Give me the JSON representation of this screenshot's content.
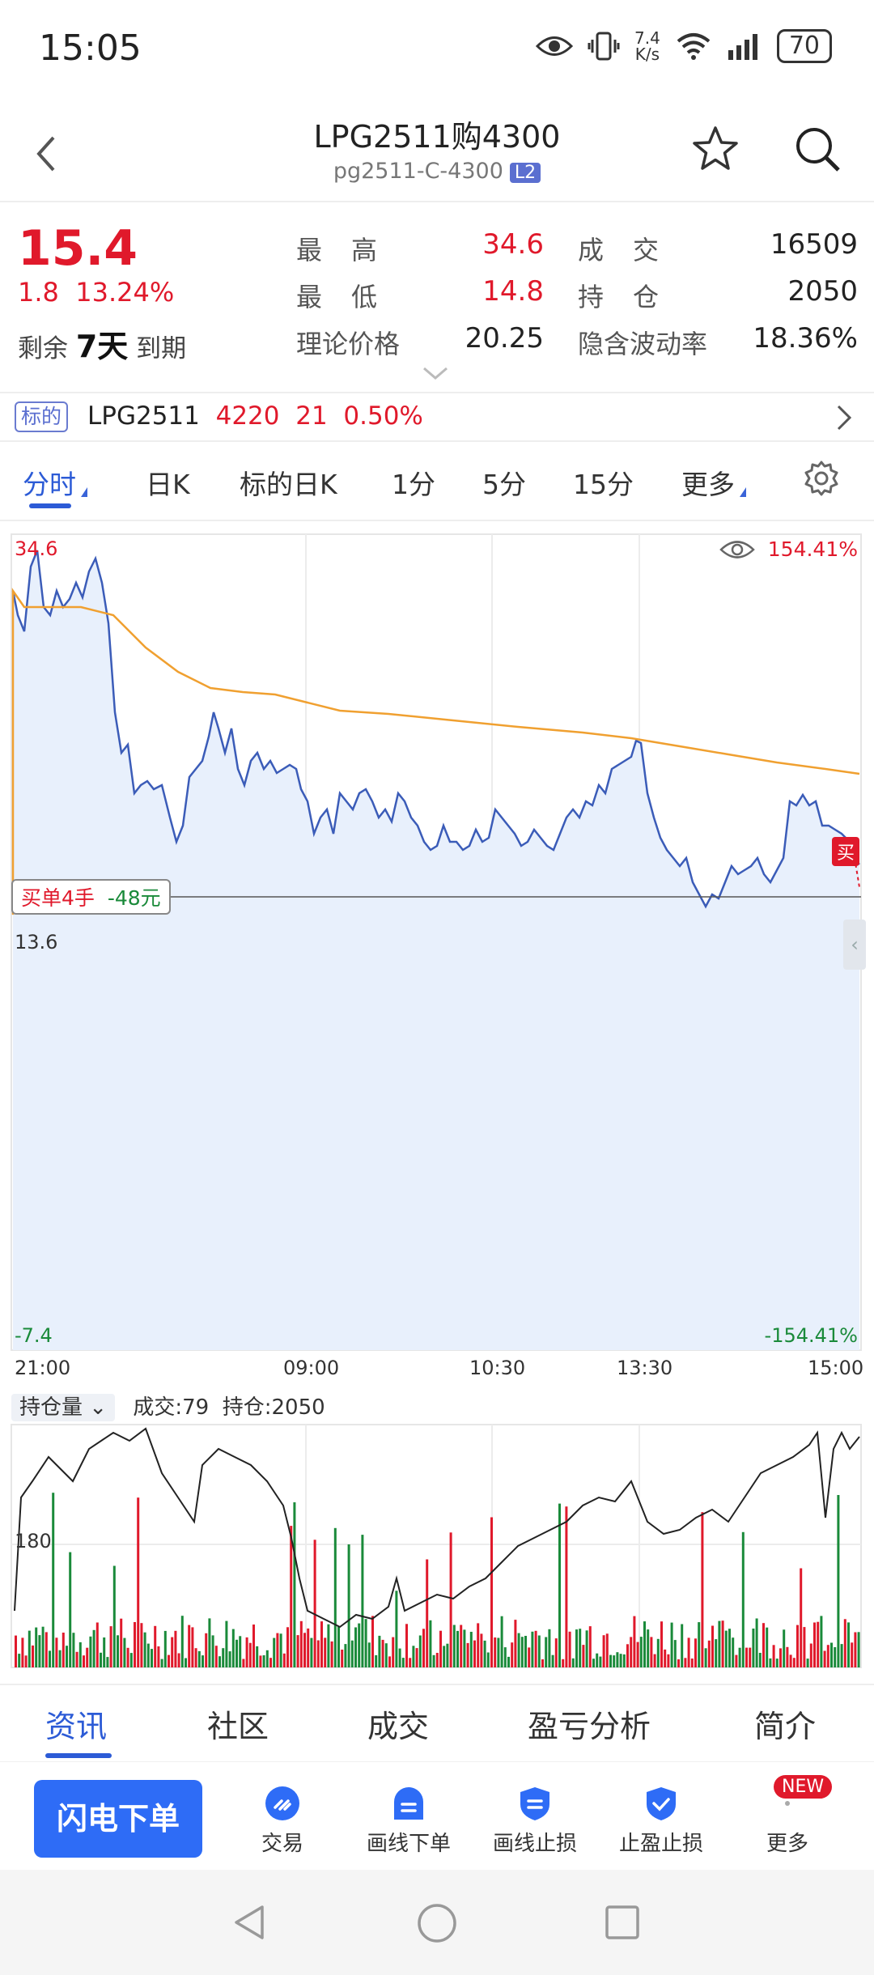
{
  "status": {
    "time": "15:05",
    "speed_top": "7.4",
    "speed_unit": "K/s",
    "network": "6",
    "battery": "70"
  },
  "title": {
    "main": "LPG2511购4300",
    "sub": "pg2511-C-4300",
    "badge": "L2"
  },
  "quote": {
    "price": "15.4",
    "change": "1.8",
    "change_pct": "13.24%",
    "remain_prefix": "剩余",
    "remain_days": "7天",
    "remain_suffix": "到期",
    "high_label": "最　高",
    "high_value": "34.6",
    "low_label": "最　低",
    "low_value": "14.8",
    "theory_label": "理论价格",
    "theory_value": "20.25",
    "volume_label": "成　交",
    "volume_value": "16509",
    "oi_label": "持　仓",
    "oi_value": "2050",
    "iv_label": "隐含波动率",
    "iv_value": "18.36%"
  },
  "underlying": {
    "tag": "标的",
    "symbol": "LPG2511",
    "price": "4220",
    "change": "21",
    "change_pct": "0.50%"
  },
  "tabs": [
    "分时",
    "日K",
    "标的日K",
    "1分",
    "5分",
    "15分",
    "更多"
  ],
  "chart": {
    "y_top": "34.6",
    "y_mid": "13.6",
    "y_bottom": "-7.4",
    "pct_top": "154.41%",
    "pct_bottom": "-154.41%",
    "x_ticks": [
      "21:00",
      "09:00",
      "10:30",
      "13:30",
      "15:00"
    ],
    "order_label": "买单4手",
    "order_pnl": "-48元",
    "buy_tag": "买",
    "colors": {
      "price": "#3b5cb8",
      "avg": "#f0a030",
      "up": "#e0192b",
      "down": "#1a8a3a"
    }
  },
  "volume_panel": {
    "selector": "持仓量",
    "volume_text": "成交:79",
    "oi_text": "持仓:2050",
    "y_tick": "180"
  },
  "info_tabs": [
    "资讯",
    "社区",
    "成交",
    "盈亏分析",
    "简介"
  ],
  "actions": {
    "flash": "闪电下单",
    "items": [
      "交易",
      "画线下单",
      "画线止损",
      "止盈止损",
      "更多"
    ],
    "new_badge": "NEW"
  }
}
